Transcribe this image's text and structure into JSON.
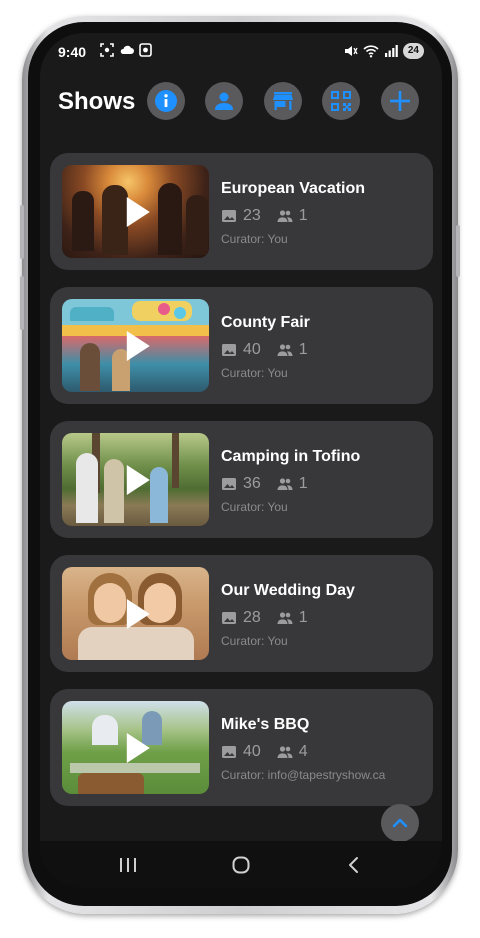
{
  "status_bar": {
    "time": "9:40",
    "battery": "24",
    "left_icons": [
      "screenshot-icon",
      "cloud-icon",
      "app-notification-icon"
    ],
    "right_icons": [
      "mute-icon",
      "wifi-icon",
      "signal-icon"
    ]
  },
  "header": {
    "title": "Shows",
    "accent_color": "#1e90ff",
    "buttons": [
      {
        "icon": "info-icon",
        "active": true
      },
      {
        "icon": "user-icon",
        "active": false
      },
      {
        "icon": "store-icon",
        "active": false
      },
      {
        "icon": "qr-code-icon",
        "active": false
      },
      {
        "icon": "add-icon",
        "active": false
      }
    ]
  },
  "shows": [
    {
      "title": "European Vacation",
      "photos": "23",
      "people": "1",
      "curator": "Curator: You",
      "thumb_icon": "party-crowd-thumbnail"
    },
    {
      "title": "County Fair",
      "photos": "40",
      "people": "1",
      "curator": "Curator: You",
      "thumb_icon": "fair-stall-thumbnail"
    },
    {
      "title": "Camping in Tofino",
      "photos": "36",
      "people": "1",
      "curator": "Curator: You",
      "thumb_icon": "kids-forest-thumbnail"
    },
    {
      "title": "Our Wedding Day",
      "photos": "28",
      "people": "1",
      "curator": "Curator: You",
      "thumb_icon": "wedding-selfie-thumbnail"
    },
    {
      "title": "Mike's BBQ",
      "photos": "40",
      "people": "4",
      "curator": "Curator: info@tapestryshow.ca",
      "thumb_icon": "picnic-thumbnail"
    }
  ],
  "navigation": [
    "recent-apps-icon",
    "home-icon",
    "back-icon"
  ]
}
